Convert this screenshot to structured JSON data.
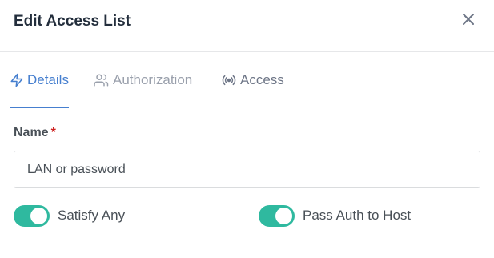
{
  "modal": {
    "title": "Edit Access List",
    "close_icon": "close-icon"
  },
  "tabs": [
    {
      "label": "Details",
      "icon": "bolt-icon",
      "active": true
    },
    {
      "label": "Authorization",
      "icon": "users-icon",
      "active": false
    },
    {
      "label": "Access",
      "icon": "broadcast-icon",
      "active": false
    }
  ],
  "form": {
    "name_label": "Name",
    "required_marker": "*",
    "name_value": "LAN or password"
  },
  "toggles": [
    {
      "label": "Satisfy Any",
      "checked": true
    },
    {
      "label": "Pass Auth to Host",
      "checked": true
    }
  ],
  "colors": {
    "accent": "#467fcf",
    "toggle_on": "#2fb99f",
    "required": "#cd201f"
  }
}
